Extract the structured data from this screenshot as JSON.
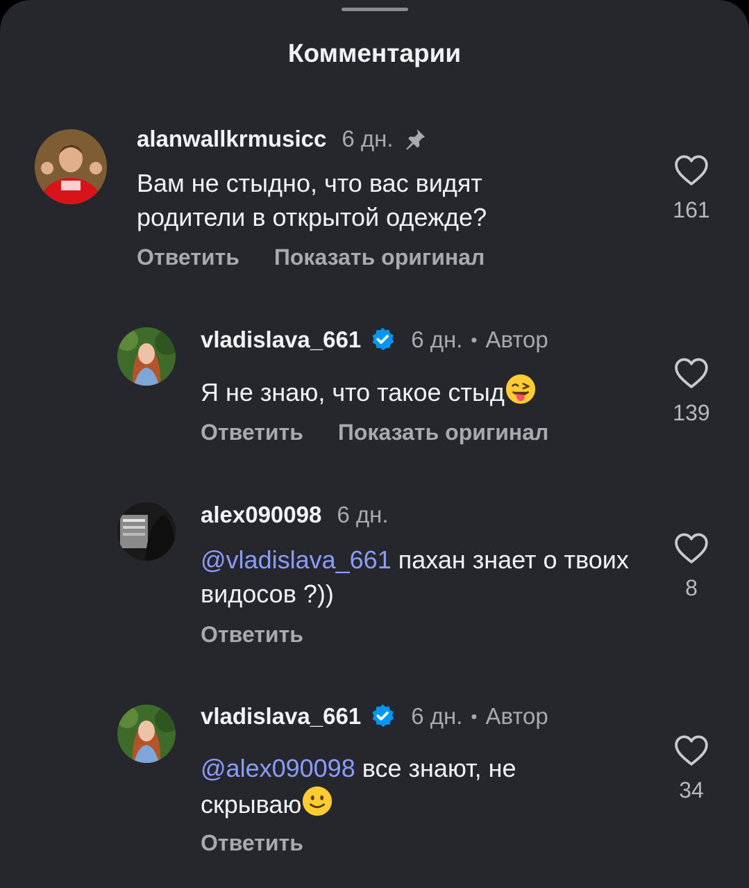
{
  "header": {
    "title": "Комментарии"
  },
  "comments": [
    {
      "username": "alanwallkrmusicc",
      "time": "6 дн.",
      "text": "Вам не стыдно, что вас видят родители в открытой одежде?",
      "actions": {
        "reply": "Ответить",
        "show_original": "Показать оригинал"
      },
      "likes": "161",
      "icons": [
        "avatar",
        "pin-icon",
        "heart-icon"
      ]
    },
    {
      "username": "vladislava_661",
      "time": "6 дн.",
      "author_label": "Автор",
      "separator": "•",
      "text": "Я не знаю, что такое стыд",
      "actions": {
        "reply": "Ответить",
        "show_original": "Показать оригинал"
      },
      "likes": "139",
      "icons": [
        "avatar",
        "verified-badge-icon",
        "winking-tongue-emoji",
        "heart-icon"
      ]
    },
    {
      "username": "alex090098",
      "time": "6 дн.",
      "mention": "@vladislava_661",
      "text": "пахан знает о твоих видосов ?))",
      "actions": {
        "reply": "Ответить"
      },
      "likes": "8",
      "icons": [
        "avatar",
        "heart-icon"
      ]
    },
    {
      "username": "vladislava_661",
      "time": "6 дн.",
      "author_label": "Автор",
      "separator": "•",
      "mention": "@alex090098",
      "text_line1": "все знают, не",
      "text_line2": "скрываю",
      "actions": {
        "reply": "Ответить"
      },
      "likes": "34",
      "icons": [
        "avatar",
        "verified-badge-icon",
        "slightly-smiling-emoji",
        "heart-icon"
      ]
    }
  ],
  "colors": {
    "background": "#25272c",
    "text": "#f2f3f5",
    "muted": "#a8aaaf",
    "mention": "#8c9cff",
    "verified": "#0095f6"
  }
}
